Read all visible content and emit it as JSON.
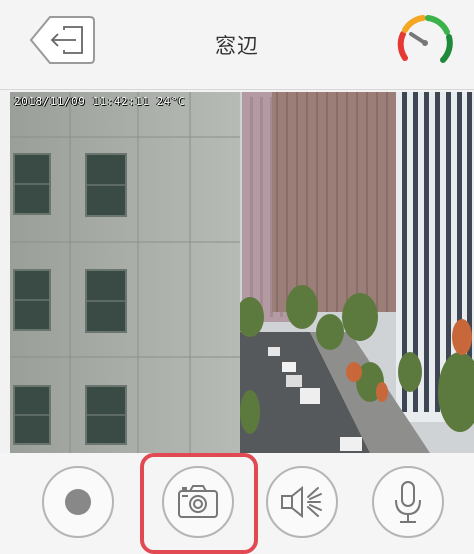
{
  "header": {
    "title": "窓辺",
    "back_icon": "back-arrow-icon",
    "signal_icon": "signal-gauge-icon"
  },
  "camera": {
    "osd_text": "2018/11/09 11:42:11 24°C"
  },
  "controls": [
    {
      "name": "record-button",
      "icon": "record-icon"
    },
    {
      "name": "snapshot-button",
      "icon": "camera-icon",
      "highlighted": true
    },
    {
      "name": "speaker-button",
      "icon": "speaker-icon"
    },
    {
      "name": "microphone-button",
      "icon": "microphone-icon"
    }
  ],
  "colors": {
    "highlight": "#e24a53",
    "gauge_red": "#e53935",
    "gauge_orange": "#f5a623",
    "gauge_green": "#3bb34a",
    "gauge_green_dark": "#1f8a3a"
  }
}
